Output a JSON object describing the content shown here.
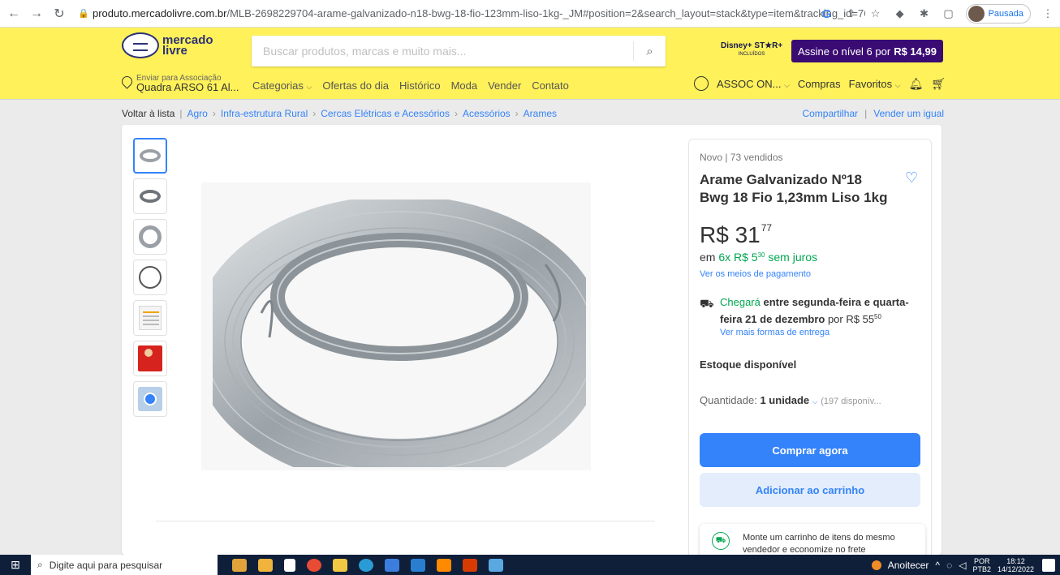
{
  "browser": {
    "url_host": "produto.mercadolivre.com.br",
    "url_path": "/MLB-2698229704-arame-galvanizado-n18-bwg-18-fio-123mm-liso-1kg-_JM#position=2&search_layout=stack&type=item&tracking_id=76...",
    "profile_label": "Pausada"
  },
  "header": {
    "logo_line1": "mercado",
    "logo_line2": "livre",
    "search_placeholder": "Buscar produtos, marcas e muito mais...",
    "disney_label": "Disney+ ST★R+",
    "disney_sub": "INCLUÍDOS",
    "promo_text": "Assine o nível 6 por",
    "promo_price": "R$ 14,99",
    "shipto_line1": "Enviar para Associação",
    "shipto_line2": "Quadra ARSO 61 Al...",
    "nav": [
      "Categorias",
      "Ofertas do dia",
      "Histórico",
      "Moda",
      "Vender",
      "Contato"
    ],
    "user_name": "ASSOC ON...",
    "purchases": "Compras",
    "favorites": "Favoritos"
  },
  "breadcrumb": {
    "back": "Voltar à lista",
    "items": [
      "Agro",
      "Infra-estrutura Rural",
      "Cercas Elétricas e Acessórios",
      "Acessórios",
      "Arames"
    ],
    "share": "Compartilhar",
    "sell_same": "Vender um igual"
  },
  "product": {
    "condition": "Novo  |  73 vendidos",
    "title": "Arame Galvanizado Nº18 Bwg 18 Fio 1,23mm Liso 1kg",
    "price_int": "R$ 31",
    "price_cents": "77",
    "installments_prefix": "em",
    "installments_main": "6x R$ 5",
    "installments_cents": "30",
    "installments_suffix": "sem juros",
    "payment_link": "Ver os meios de pagamento",
    "ship_word": "Chegará",
    "ship_when": "entre segunda-feira e quarta-feira 21 de dezembro",
    "ship_price_prefix": "por R$ 55",
    "ship_price_cents": "50",
    "ship_link": "Ver mais formas de entrega",
    "stock": "Estoque disponível",
    "qty_label": "Quantidade:",
    "qty_value": "1 unidade",
    "qty_available": "(197 disponív...",
    "buy_now": "Comprar agora",
    "add_cart": "Adicionar ao carrinho",
    "tip": "Monte um carrinho de itens do mesmo vendedor e economize no frete"
  },
  "taskbar": {
    "search_placeholder": "Digite aqui para pesquisar",
    "weather": "Anoitecer",
    "lang1": "POR",
    "lang2": "PTB2",
    "time": "18:12",
    "date": "14/12/2022"
  }
}
